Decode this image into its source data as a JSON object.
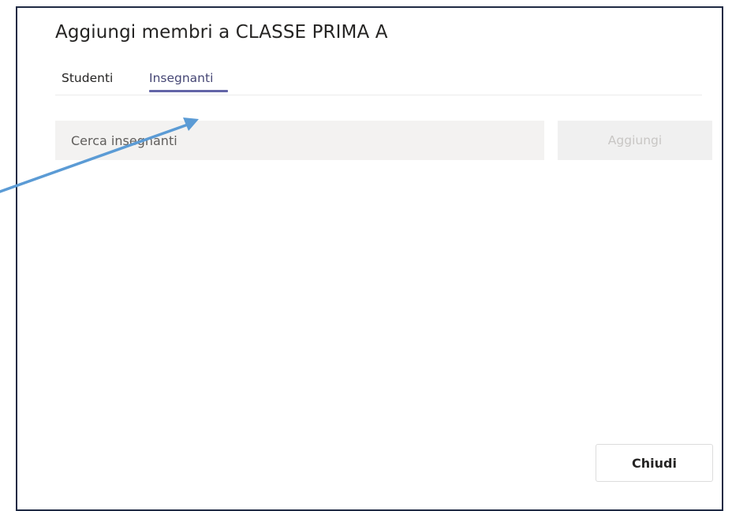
{
  "dialog": {
    "title": "Aggiungi membri a CLASSE PRIMA A"
  },
  "tabs": [
    {
      "label": "Studenti",
      "active": false
    },
    {
      "label": "Insegnanti",
      "active": true
    }
  ],
  "search": {
    "placeholder": "Cerca insegnanti",
    "value": ""
  },
  "actions": {
    "add_label": "Aggiungi",
    "add_enabled": false,
    "close_label": "Chiudi"
  },
  "colors": {
    "accent": "#6264a7",
    "annotation_arrow": "#5b9bd5",
    "frame_border": "#1f2a44"
  }
}
